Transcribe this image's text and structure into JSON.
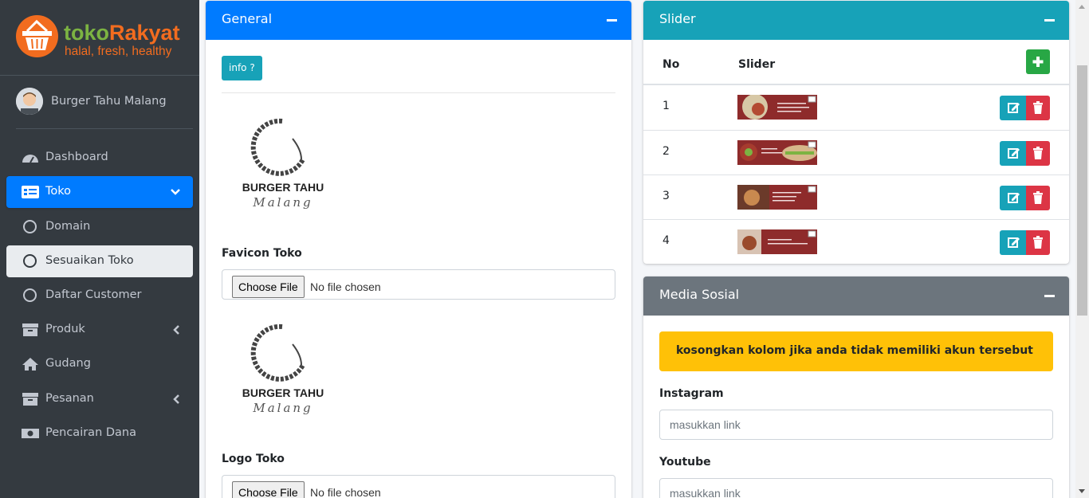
{
  "brand": {
    "name_part1": "toko",
    "name_part2": "Rakyat",
    "tagline": "halal, fresh, healthy",
    "primary_color": "#f26c1f",
    "secondary_color": "#7cb342"
  },
  "user": {
    "name": "Burger Tahu Malang"
  },
  "sidebar": {
    "items": [
      {
        "label": "Dashboard",
        "icon": "dashboard-icon"
      },
      {
        "label": "Toko",
        "icon": "store-icon",
        "state": "active-expanded"
      },
      {
        "label": "Domain",
        "icon": "circle-icon"
      },
      {
        "label": "Sesuaikan Toko",
        "icon": "circle-icon",
        "state": "selected"
      },
      {
        "label": "Daftar Customer",
        "icon": "circle-icon"
      },
      {
        "label": "Produk",
        "icon": "archive-icon"
      },
      {
        "label": "Gudang",
        "icon": "home-icon"
      },
      {
        "label": "Pesanan",
        "icon": "archive-icon"
      },
      {
        "label": "Pencairan Dana",
        "icon": "money-icon"
      }
    ]
  },
  "general": {
    "title": "General",
    "info_label": "info ?",
    "logo_text_line1": "BURGER TAHU",
    "logo_text_line2": "Malang",
    "favicon_label": "Favicon Toko",
    "logo_label": "Logo Toko",
    "file_button": "Choose File",
    "file_status": "No file chosen",
    "header_color": "#007bff"
  },
  "slider": {
    "title": "Slider",
    "col_no": "No",
    "col_slider": "Slider",
    "rows": [
      {
        "no": "1"
      },
      {
        "no": "2"
      },
      {
        "no": "3"
      },
      {
        "no": "4"
      }
    ],
    "header_color": "#17a2b8"
  },
  "social": {
    "title": "Media Sosial",
    "alert": "kosongkan kolom jika anda tidak memiliki akun tersebut",
    "instagram_label": "Instagram",
    "instagram_placeholder": "masukkan link",
    "youtube_label": "Youtube",
    "youtube_placeholder": "masukkan link",
    "header_color": "#6c757d"
  }
}
